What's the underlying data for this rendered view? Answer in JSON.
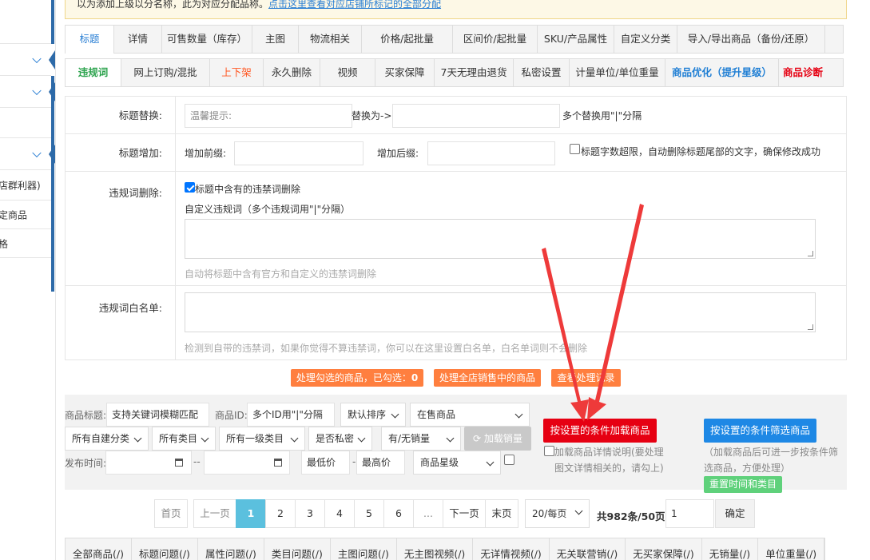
{
  "notice": {
    "text": "以为添加上级以分名称，此为对应分配品称。",
    "link": "点击这里查看对应店铺所标记的全部分配"
  },
  "sidebar": {
    "items": [
      {
        "label": ""
      },
      {
        "label": ""
      },
      {
        "label": ""
      },
      {
        "label": ""
      },
      {
        "label": "店群利器)"
      },
      {
        "label": "定商品"
      },
      {
        "label": "格"
      }
    ]
  },
  "tabs_top": [
    {
      "label": "标题",
      "active": true
    },
    {
      "label": "详情"
    },
    {
      "label": "可售数量（库存）"
    },
    {
      "label": "主图"
    },
    {
      "label": "物流相关"
    },
    {
      "label": "价格/起批量"
    },
    {
      "label": "区间价/起批量"
    },
    {
      "label": "SKU/产品属性"
    },
    {
      "label": "自定义分类"
    },
    {
      "label": "导入/导出商品（备份/还原）"
    }
  ],
  "tabs_sub": [
    {
      "label": "违规词",
      "style": "active"
    },
    {
      "label": "网上订购/混批"
    },
    {
      "label": "上下架",
      "style": "orange"
    },
    {
      "label": "永久删除"
    },
    {
      "label": "视频"
    },
    {
      "label": "买家保障"
    },
    {
      "label": "7天无理由退货"
    },
    {
      "label": "私密设置"
    },
    {
      "label": "计量单位/单位重量"
    },
    {
      "label": "商品优化（提升星级）",
      "style": "blue"
    },
    {
      "label": "商品诊断",
      "style": "red"
    }
  ],
  "form": {
    "replace": {
      "label": "标题替换:",
      "placeholder": "温馨提示:",
      "arrow_text": "替换为->",
      "hint": "多个替换用\"|\"分隔"
    },
    "append": {
      "label": "标题增加:",
      "prefix_label": "增加前缀:",
      "suffix_label": "增加后缀:",
      "checkbox_label": "标题字数超限，自动删除标题尾部的文字，确保修改成功",
      "checked": false
    },
    "violation": {
      "label": "违规词删除:",
      "checkbox_label": "标题中含有的违禁词删除",
      "checked": true,
      "custom_label": "自定义违规词（多个违规词用\"|\"分隔）",
      "hint": "自动将标题中含有官方和自定义的违禁词删除"
    },
    "whitelist": {
      "label": "违规词白名单:",
      "hint": "检测到自带的违禁词，如果你觉得不算违禁词，你可以在这里设置白名单，白名单词则不会删除"
    }
  },
  "actions": {
    "process_selected": "处理勾选的商品，已勾选：",
    "selected_count": "0",
    "process_all": "处理全店销售中的商品",
    "view_records": "查看处理记录"
  },
  "filter": {
    "title_label": "商品标题:",
    "title_placeholder": "支持关键词模糊匹配",
    "id_label": "商品ID:",
    "id_placeholder": "多个ID用\"|\"分隔",
    "sort": "默认排序",
    "status": "在售商品",
    "category": "所有自建分类",
    "cat2": "所有类目",
    "cat3": "所有一级类目",
    "private": "是否私密",
    "sales": "有/无销量",
    "load_sales": "加载销量",
    "time_label": "发布时间:",
    "dash": "--",
    "min_price": "最低价",
    "price_dash": "-",
    "max_price": "最高价",
    "star": "商品星级",
    "load_by_condition": "按设置的条件加载商品",
    "filter_by_condition": "按设置的条件筛选商品",
    "detail_note": "加载商品详情说明(要处理图文详情相关的，请勾上)",
    "filter_note": "（加载商品后可进一步按条件筛选商品，方便处理）",
    "reset": "重置时间和类目"
  },
  "pagination": {
    "first": "首页",
    "prev": "上一页",
    "pages": [
      "1",
      "2",
      "3",
      "4",
      "5",
      "6",
      "..."
    ],
    "current": "1",
    "next": "下一页",
    "last": "末页",
    "per_page": "20/每页",
    "total": "共982条/50页",
    "goto_value": "1",
    "confirm": "确定"
  },
  "bottom_tabs": [
    "全部商品(/)",
    "标题问题(/)",
    "属性问题(/)",
    "类目问题(/)",
    "主图问题(/)",
    "无主图视频(/)",
    "无详情视频(/)",
    "无关联营销(/)",
    "无买家保障(/)",
    "无销量(/)",
    "单位重量(/)"
  ],
  "colors": {
    "accent": "#2a7fd4",
    "red": "#e60012",
    "blue": "#1e88e5",
    "orange": "#ff7f3f",
    "green": "#5fd17b",
    "arrow": "#ee3a3a"
  }
}
